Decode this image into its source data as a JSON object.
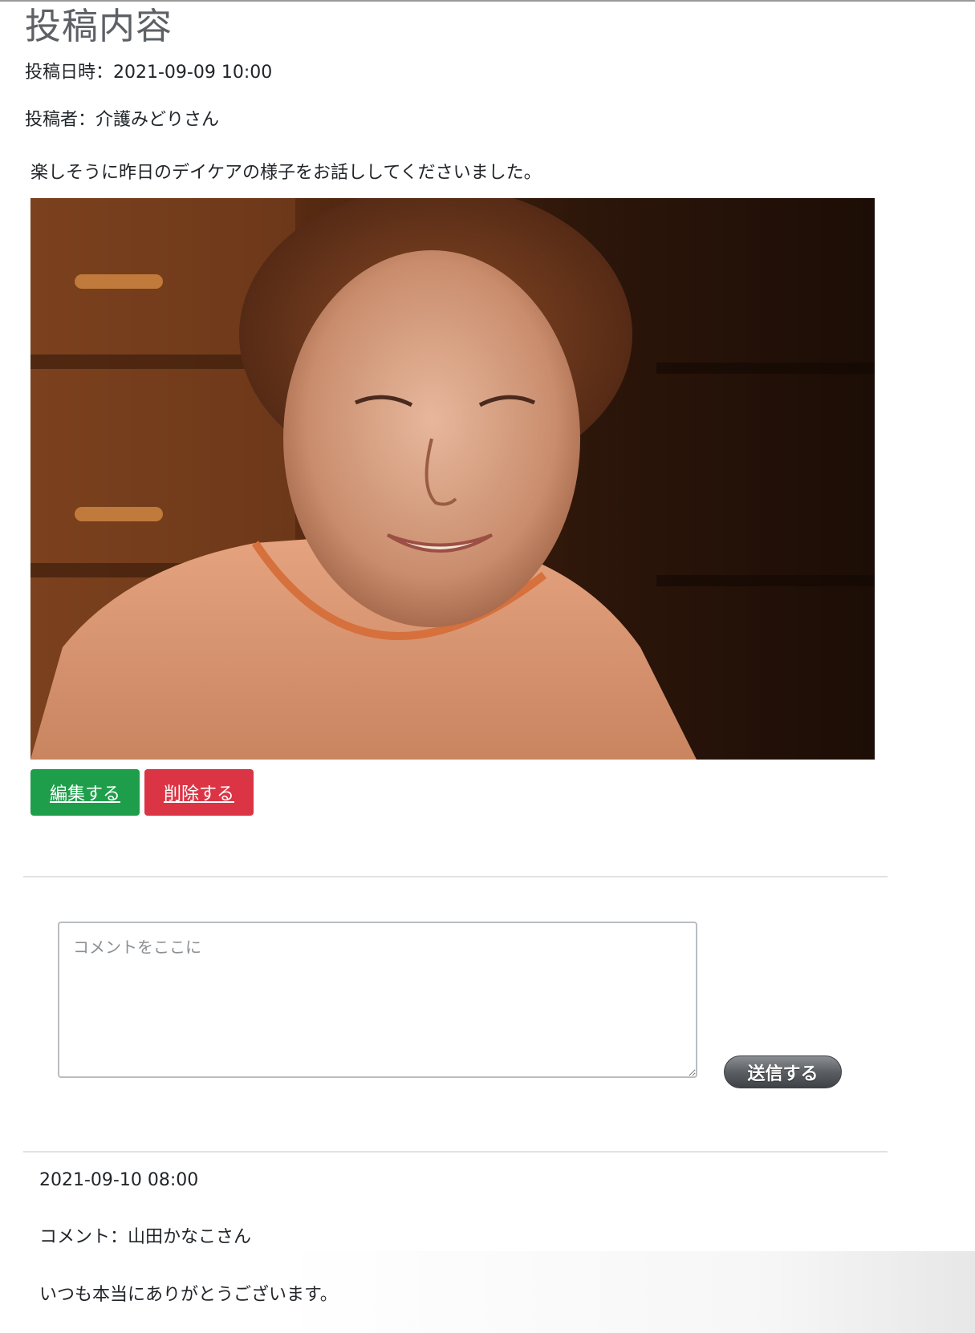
{
  "page": {
    "title": "投稿内容"
  },
  "post": {
    "date_line": "投稿日時：2021-09-09 10:00",
    "author_line": "投稿者：介護みどりさん",
    "body": "楽しそうに昨日のデイケアの様子をお話ししてくださいました。",
    "photo_description": "smiling elderly woman in an orange shirt",
    "edit_label": "編集する",
    "delete_label": "削除する",
    "colors": {
      "edit": "#1e9e4a",
      "delete": "#db3445"
    }
  },
  "comment_form": {
    "placeholder": "コメントをここに",
    "value": "",
    "submit_label": "送信する"
  },
  "comments": [
    {
      "date": "2021-09-10 08:00",
      "author_line": "コメント：山田かなこさん",
      "text": "いつも本当にありがとうございます。"
    }
  ]
}
